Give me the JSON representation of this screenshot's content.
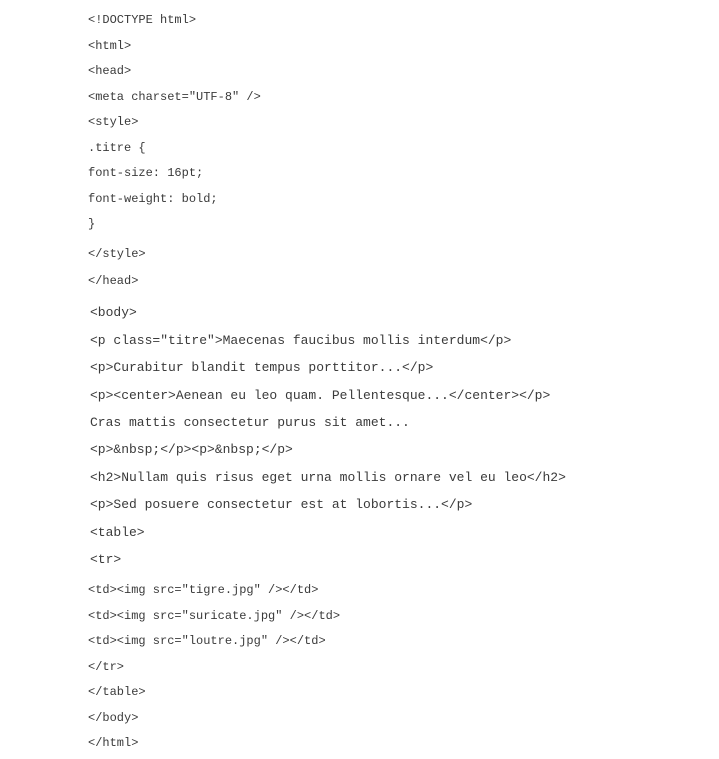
{
  "document": {
    "head_lines": [
      "<!DOCTYPE html>",
      "<html>",
      "<head>",
      "<meta charset=\"UTF-8\" />",
      "<style>",
      ".titre {",
      "font-size: 16pt;",
      "font-weight: bold;",
      "}",
      "</style>",
      "</head>"
    ],
    "body_lines": [
      "<body>",
      "<p class=\"titre\">Maecenas faucibus mollis interdum</p>",
      "<p>Curabitur blandit tempus porttitor...</p>",
      "<p><center>Aenean eu leo quam. Pellentesque...</center></p>",
      "Cras mattis consectetur purus sit amet...",
      "<p>&nbsp;</p><p>&nbsp;</p>",
      "<h2>Nullam quis risus eget urna mollis ornare vel eu leo</h2>",
      "<p>Sed posuere consectetur est at lobortis...</p>",
      "<table>",
      "<tr>"
    ],
    "table_lines": [
      "<td><img src=\"tigre.jpg\" /></td>",
      "<td><img src=\"suricate.jpg\" /></td>",
      "<td><img src=\"loutre.jpg\" /></td>",
      "</tr>",
      "</table>",
      "</body>",
      "</html>"
    ]
  }
}
